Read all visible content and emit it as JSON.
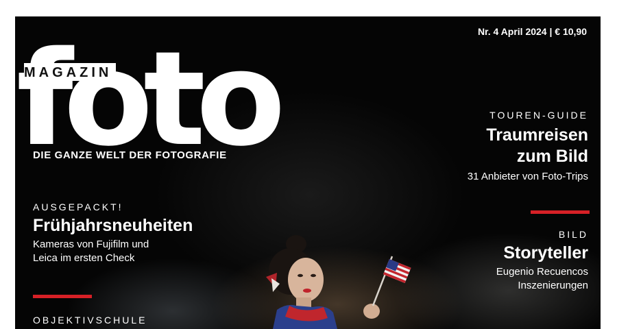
{
  "masthead": {
    "logo_word": "foto",
    "logo_label": "MAGAZIN",
    "slogan": "DIE GANZE WELT DER FOTOGRAFIE",
    "issue_line": "Nr. 4  April 2024 | € 10,90"
  },
  "stories": {
    "touren": {
      "kicker": "TOUREN-GUIDE",
      "headline_1": "Traumreisen",
      "headline_2": "zum Bild",
      "sub": "31 Anbieter von Foto-Trips"
    },
    "ausgepackt": {
      "kicker": "AUSGEPACKT!",
      "headline": "Frühjahrsneuheiten",
      "sub_1": "Kameras von Fujifilm und",
      "sub_2": "Leica im ersten Check"
    },
    "bild": {
      "kicker": "BILD",
      "headline": "Storyteller",
      "sub_1": "Eugenio Recuencos",
      "sub_2": "Inszenierungen"
    },
    "objektiv": {
      "kicker": "OBJEKTIVSCHULE"
    }
  },
  "colors": {
    "accent_red": "#d62026",
    "background": "#050505",
    "text": "#ffffff"
  },
  "cover_image": {
    "subject": "woman holding small american flag"
  }
}
